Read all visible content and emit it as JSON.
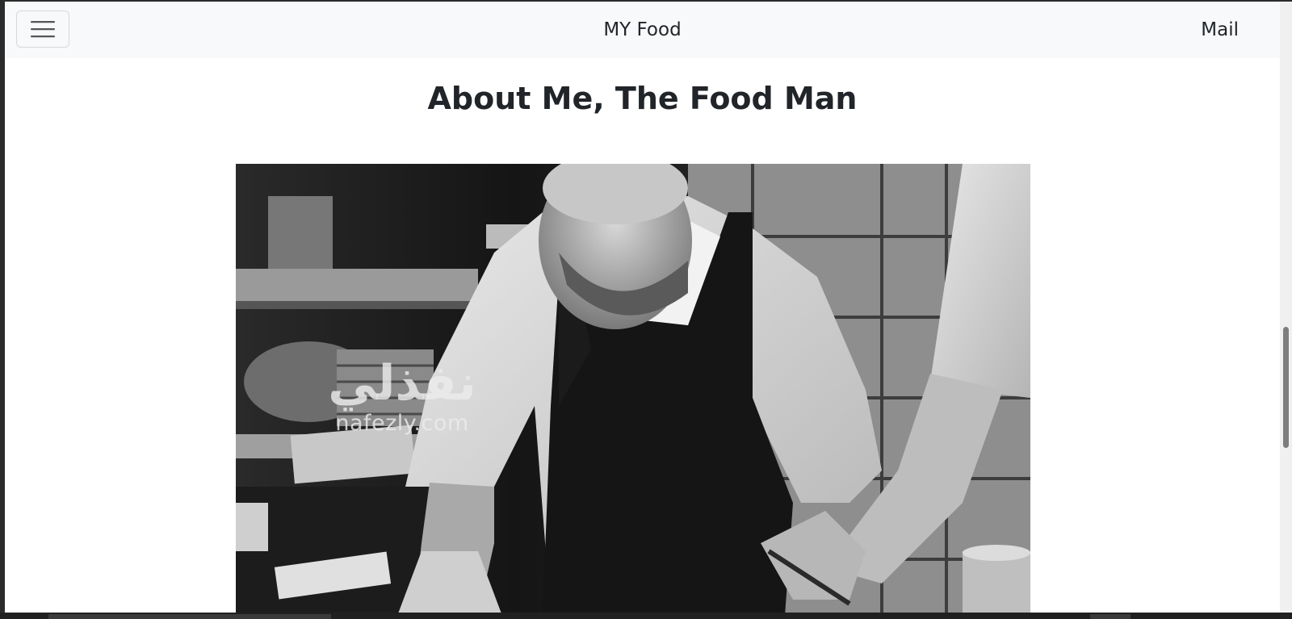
{
  "navbar": {
    "brand": "MY Food",
    "mail_link": "Mail",
    "menu_icon": "hamburger-menu-icon"
  },
  "main": {
    "heading": "About Me, The Food Man",
    "photo": {
      "description_icon": "chef-photo",
      "watermark_arabic": "نفذلي",
      "watermark_latin": "nafezly.com"
    }
  },
  "colors": {
    "navbar_bg": "#f8f9fa",
    "text": "#212529",
    "page_bg": "#ffffff"
  }
}
